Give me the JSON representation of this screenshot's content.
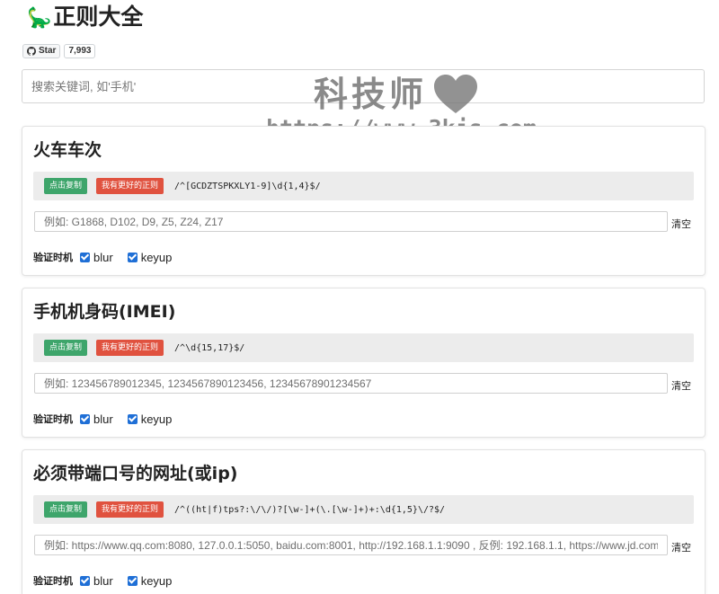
{
  "page": {
    "title": "正则大全",
    "title_icon": "🦕",
    "github": {
      "star_label": "Star",
      "star_count": "7,993"
    },
    "search_placeholder": "搜索关键词, 如'手机'"
  },
  "watermark": {
    "line1": "科技师",
    "line2": "https://www.3kjs.com"
  },
  "labels": {
    "copy_button": "点击复制",
    "better_button": "我有更好的正则",
    "clear": "清空",
    "verify_timing": "验证时机",
    "blur": "blur",
    "keyup": "keyup"
  },
  "cards": [
    {
      "title": "火车车次",
      "regex": "/^[GCDZTSPKXLY1-9]\\d{1,4}$/",
      "placeholder": "例如: G1868, D102, D9, Z5, Z24, Z17",
      "blur_checked": true,
      "keyup_checked": true
    },
    {
      "title": "手机机身码(IMEI)",
      "regex": "/^\\d{15,17}$/",
      "placeholder": "例如: 123456789012345, 1234567890123456, 12345678901234567",
      "blur_checked": true,
      "keyup_checked": true
    },
    {
      "title": "必须带端口号的网址(或ip)",
      "regex": "/^((ht|f)tps?:\\/\\/)?[\\w-]+(\\.[\\w-]+)+:\\d{1,5}\\/?$/",
      "placeholder": "例如: https://www.qq.com:8080, 127.0.0.1:5050, baidu.com:8001, http://192.168.1.1:9090 , 反例: 192.168.1.1, https://www.jd.com",
      "blur_checked": true,
      "keyup_checked": true
    }
  ],
  "colors": {
    "copy_button": "#3ea56b",
    "better_button": "#e0523f",
    "checkbox": "#1f6fd6",
    "regex_bar": "#ececec"
  }
}
